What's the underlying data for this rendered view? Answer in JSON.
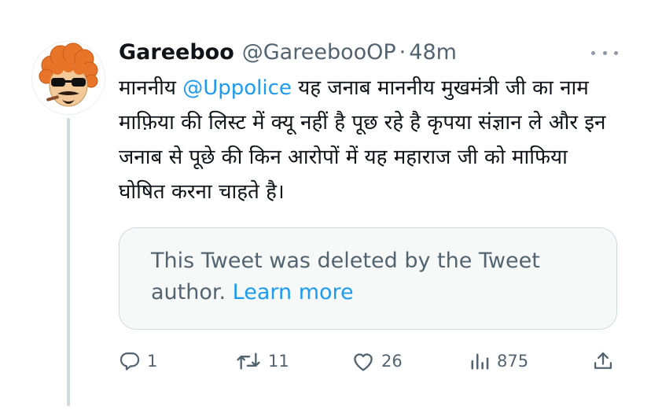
{
  "tweet": {
    "display_name": "Gareeboo",
    "handle": "@GareebooOP",
    "separator": "·",
    "time": "48m",
    "text_part1": "माननीय ",
    "mention": "@Uppolice",
    "text_part2": " यह जनाब माननीय मुखमंत्री जी का नाम माफ़िया की लिस्ट में क्यू नहीं है पूछ रहे है कृपया संज्ञान ले और इन जनाब से पूछे की किन आरोपों में यह महाराज जी को माफिया घोषित करना चाहते है।"
  },
  "quoted": {
    "message": "This Tweet was deleted by the Tweet author. ",
    "link_label": "Learn more"
  },
  "actions": {
    "reply_count": "1",
    "retweet_count": "11",
    "like_count": "26",
    "views_count": "875"
  },
  "icons": {
    "more": "more-horizontal-icon",
    "reply": "reply-bubble-icon",
    "retweet": "retweet-icon",
    "like": "heart-icon",
    "views": "analytics-bars-icon",
    "share": "share-upload-icon"
  },
  "colors": {
    "text": "#0f1419",
    "secondary": "#536471",
    "accent": "#1d9bf0",
    "border": "#cfd9de",
    "quote_bg": "#f7f9f9"
  }
}
